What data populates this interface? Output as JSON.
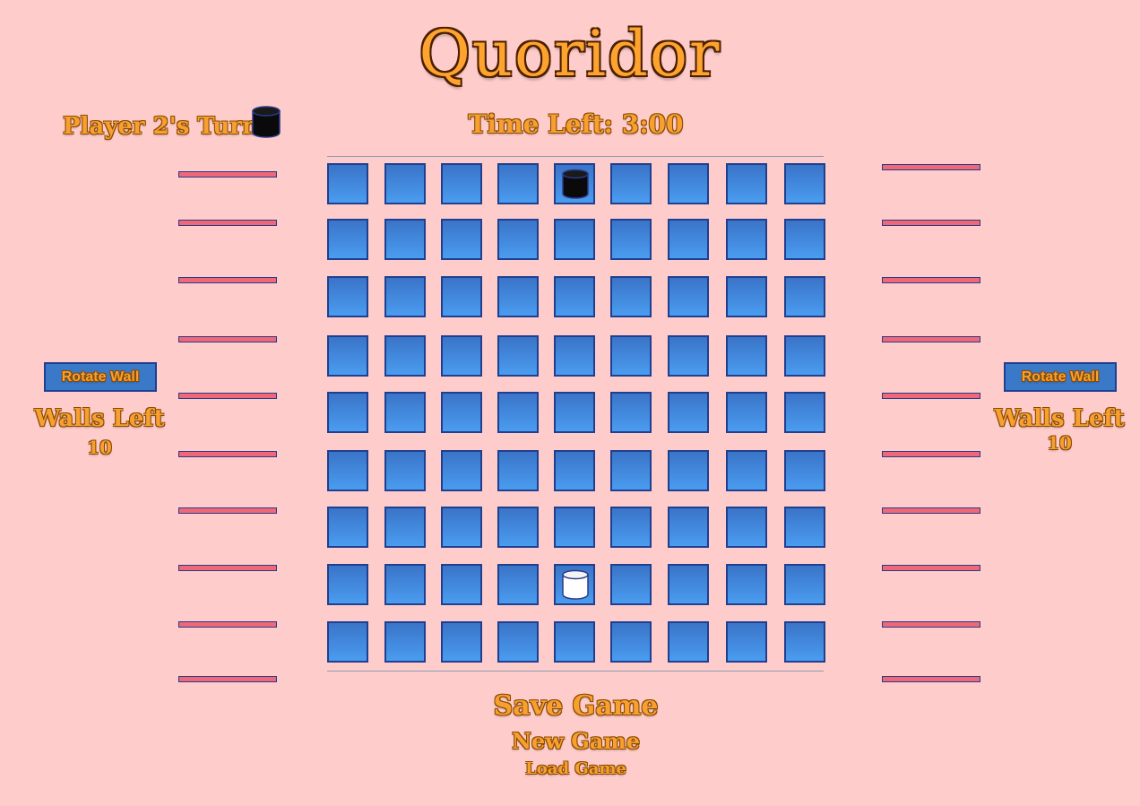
{
  "game": {
    "title": "Quoridor",
    "turn_text": "Player 2's Turn",
    "timer_text": "Time Left: 3:00",
    "colors": {
      "background": "#ffcccc",
      "title": "#ffa32f",
      "cell_top": "#3a74c8",
      "cell_bottom": "#4a9cf0",
      "wall": "#ee6877",
      "pawn_dark": "#0a0a0a",
      "pawn_light": "#ffffff"
    }
  },
  "left_panel": {
    "rotate_label": "Rotate Wall",
    "walls_left_label": "Walls Left",
    "walls_left_count": "10"
  },
  "right_panel": {
    "rotate_label": "Rotate Wall",
    "walls_left_label": "Walls Left",
    "walls_left_count": "10"
  },
  "board": {
    "rows": 9,
    "cols": 9,
    "pawns": [
      {
        "player": "Player 2",
        "color": "dark",
        "row": 1,
        "col": 5
      },
      {
        "player": "Player 1",
        "color": "light",
        "row": 8,
        "col": 5
      }
    ]
  },
  "menu": {
    "save": "Save Game",
    "new": "New Game",
    "load": "Load Game"
  }
}
